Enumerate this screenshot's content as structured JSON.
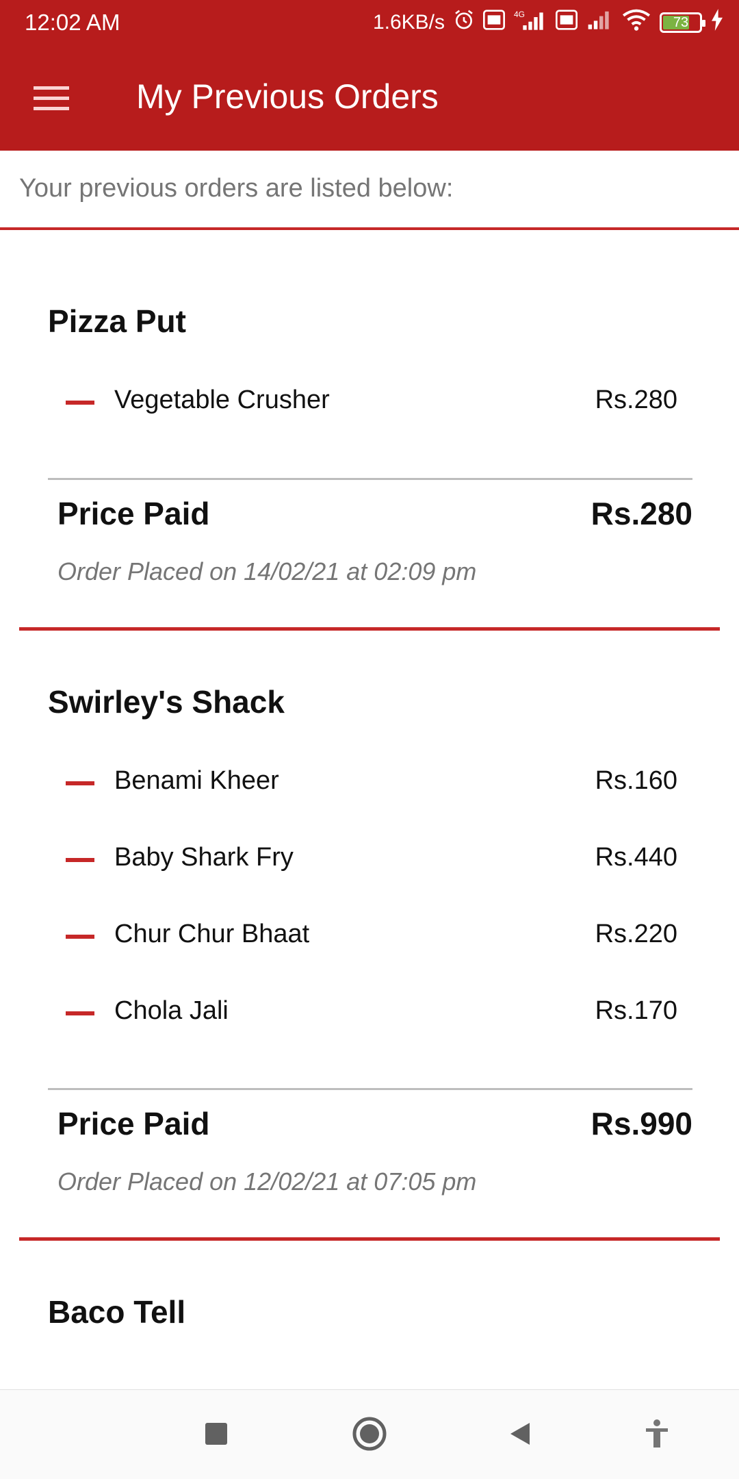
{
  "status_bar": {
    "time": "12:02 AM",
    "speed": "1.6KB/s",
    "network": "4G",
    "battery": "73",
    "battery_level": 0.73
  },
  "app_bar": {
    "title": "My Previous Orders",
    "menu_icon": "hamburger-menu-icon"
  },
  "subtitle": "Your previous orders are listed below:",
  "orders": [
    {
      "restaurant": "Pizza Put",
      "items": [
        {
          "name": "Vegetable Crusher",
          "price": "Rs.280"
        }
      ],
      "price_paid_label": "Price Paid",
      "price_paid": "Rs.280",
      "placed": "Order Placed on 14/02/21 at 02:09 pm"
    },
    {
      "restaurant": "Swirley's Shack",
      "items": [
        {
          "name": "Benami Kheer",
          "price": "Rs.160"
        },
        {
          "name": "Baby Shark Fry",
          "price": "Rs.440"
        },
        {
          "name": "Chur Chur Bhaat",
          "price": "Rs.220"
        },
        {
          "name": "Chola Jali",
          "price": "Rs.170"
        }
      ],
      "price_paid_label": "Price Paid",
      "price_paid": "Rs.990",
      "placed": "Order Placed on 12/02/21 at 07:05 pm"
    },
    {
      "restaurant": "Baco Tell"
    }
  ],
  "colors": {
    "primary": "#b71c1c",
    "accent": "#c62828",
    "muted_text": "#757575"
  },
  "nav_bar": {
    "icons": [
      "recents-square-icon",
      "home-circle-icon",
      "back-triangle-icon",
      "accessibility-icon"
    ]
  }
}
